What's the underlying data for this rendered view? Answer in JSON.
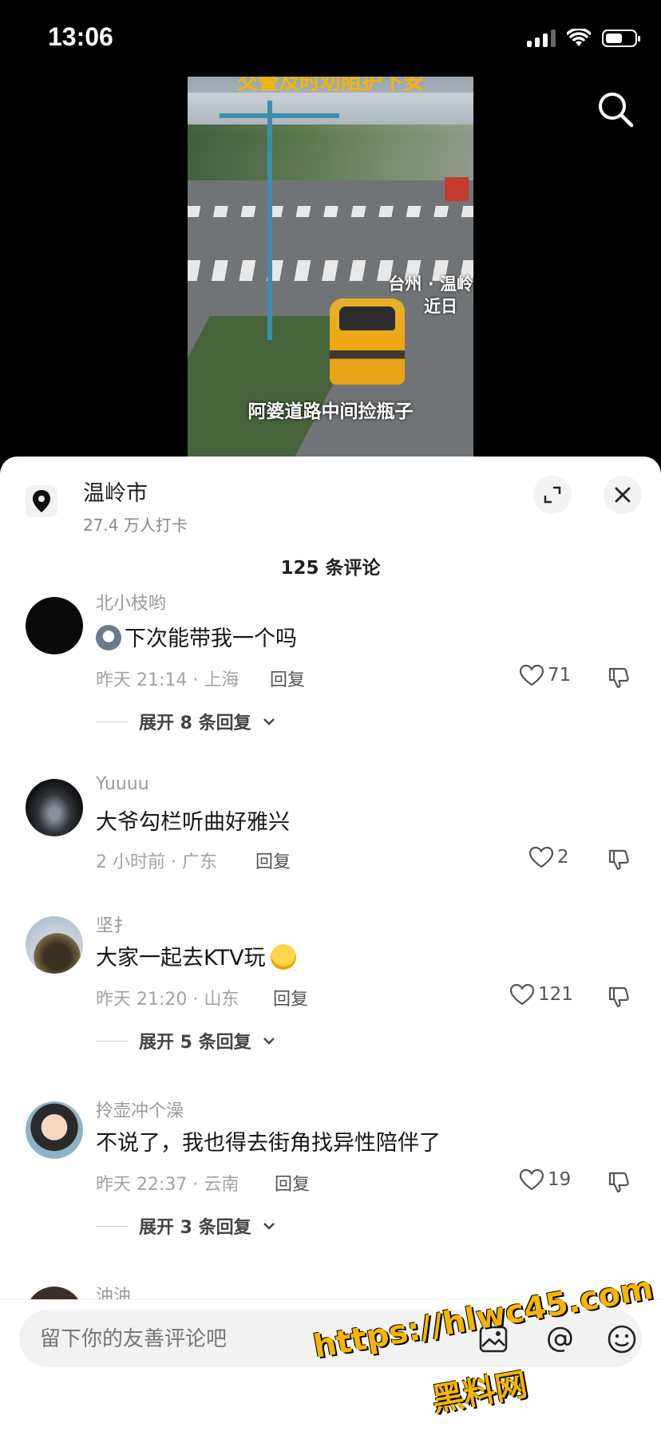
{
  "status_bar": {
    "time": "13:06"
  },
  "video": {
    "top_caption": "交警及时劝阻护下安",
    "location_overlay_1": "台州 · 温岭",
    "location_overlay_2": "近日",
    "subtitle": "阿婆道路中间捡瓶子"
  },
  "location": {
    "name": "温岭市",
    "checkins": "27.4 万人打卡"
  },
  "comments_count": "125 条评论",
  "comments": [
    {
      "username": "北小枝哟",
      "text": "下次能带我一个吗",
      "time_place": "昨天 21:14 · 上海",
      "reply": "回复",
      "likes": "71",
      "expand": "展开 8 条回复"
    },
    {
      "username": "Yuuuu",
      "text": "大爷勾栏听曲好雅兴",
      "time_place": "2 小时前 · 广东",
      "reply": "回复",
      "likes": "2"
    },
    {
      "username": "坚扌",
      "text": "大家一起去KTV玩",
      "time_place": "昨天 21:20 · 山东",
      "reply": "回复",
      "likes": "121",
      "expand": "展开 5 条回复"
    },
    {
      "username": "拎壶冲个澡",
      "text": "不说了，我也得去街角找异性陪伴了",
      "time_place": "昨天 22:37 · 云南",
      "reply": "回复",
      "likes": "19",
      "expand": "展开 3 条回复"
    },
    {
      "username": "油油"
    }
  ],
  "input": {
    "placeholder": "留下你的友善评论吧"
  },
  "watermark": {
    "line1": "https://hlwc45.com",
    "line2": "黑料网"
  }
}
